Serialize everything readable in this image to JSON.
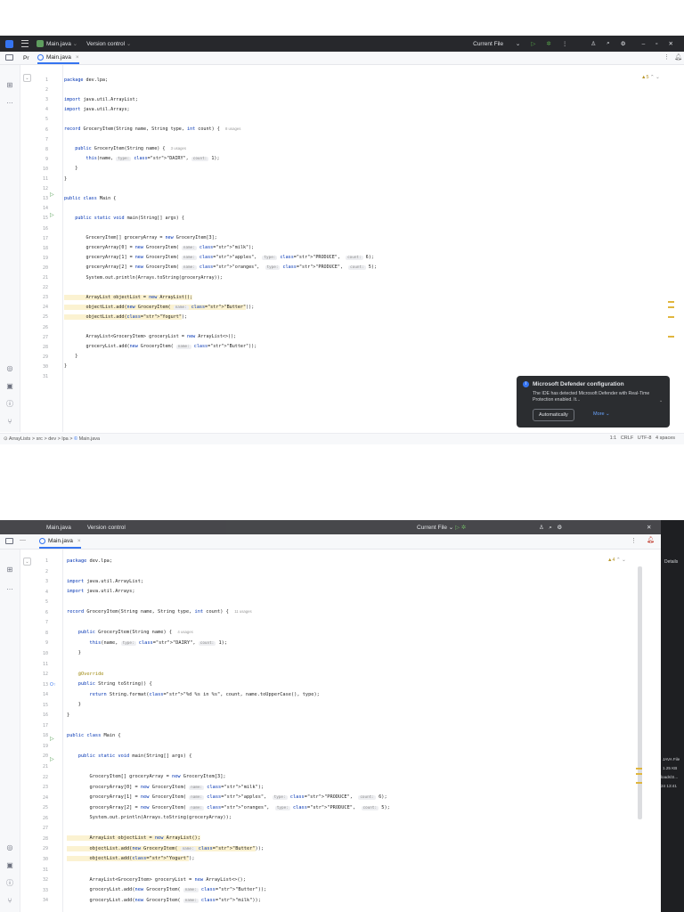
{
  "shot1": {
    "titlebar": {
      "file": "Main.java",
      "vcs": "Version control",
      "run_config": "Current File"
    },
    "tabs": [
      "Pr",
      "Main.java"
    ],
    "inspections": "▲5",
    "code": [
      {
        "n": "1",
        "t": "package dev.lpa;"
      },
      {
        "n": "2",
        "t": ""
      },
      {
        "n": "3",
        "t": "import java.util.ArrayList;"
      },
      {
        "n": "4",
        "t": "import java.util.Arrays;"
      },
      {
        "n": "5",
        "t": ""
      },
      {
        "n": "6",
        "t": "record GroceryItem(String name, String type, int count) {",
        "usage": "8 usages"
      },
      {
        "n": "7",
        "t": ""
      },
      {
        "n": "8",
        "t": "    public GroceryItem(String name) {",
        "usage": "3 usages"
      },
      {
        "n": "9",
        "t": "        this(name, ",
        "h1": "type:",
        "s1": "\"DAIRY\"",
        ", ": "",
        "h2": "count:",
        "s2": "1);"
      },
      {
        "n": "10",
        "t": "    }"
      },
      {
        "n": "11",
        "t": "}"
      },
      {
        "n": "12",
        "t": ""
      },
      {
        "n": "13",
        "t": "public class Main {"
      },
      {
        "n": "14",
        "t": ""
      },
      {
        "n": "15",
        "t": "    public static void main(String[] args) {"
      },
      {
        "n": "16",
        "t": ""
      },
      {
        "n": "17",
        "t": "        GroceryItem[] groceryArray = new GroceryItem[3];"
      },
      {
        "n": "18",
        "t": "        groceryArray[0] = new GroceryItem( name: \"milk\");"
      },
      {
        "n": "19",
        "t": "        groceryArray[1] = new GroceryItem( name: \"apples\",  type: \"PRODUCE\",  count: 6);"
      },
      {
        "n": "20",
        "t": "        groceryArray[2] = new GroceryItem( name: \"oranges\",  type: \"PRODUCE\",  count: 5);"
      },
      {
        "n": "21",
        "t": "        System.out.println(Arrays.toString(groceryArray));"
      },
      {
        "n": "22",
        "t": ""
      },
      {
        "n": "23",
        "t": "        ArrayList objectList = new ArrayList();"
      },
      {
        "n": "24",
        "t": "        objectList.add(new GroceryItem( name: \"Butter\"));"
      },
      {
        "n": "25",
        "t": "        objectList.add(\"Yogurt\");"
      },
      {
        "n": "26",
        "t": ""
      },
      {
        "n": "27",
        "t": "        ArrayList<GroceryItem> groceryList = new ArrayList<>();"
      },
      {
        "n": "28",
        "t": "        groceryList.add(new GroceryItem( name: \"Butter\"));"
      },
      {
        "n": "29",
        "t": "    }"
      },
      {
        "n": "30",
        "t": "}"
      },
      {
        "n": "31",
        "t": ""
      }
    ],
    "notification": {
      "title": "Microsoft Defender configuration",
      "body": "The IDE has detected Microsoft Defender with Real-Time Protection enabled. It...",
      "button": "Automatically",
      "more": "More"
    },
    "status": {
      "breadcrumb": [
        "ArrayLists",
        "src",
        "dev",
        "lpa",
        "Main.java"
      ],
      "position": "1:1",
      "line_sep": "CRLF",
      "encoding": "UTF-8",
      "indent": "4 spaces"
    }
  },
  "shot2": {
    "titlebar": {
      "file": "Main.java",
      "vcs": "Version control",
      "run_config": "Current File"
    },
    "tabs": [
      "Main.java"
    ],
    "inspections": "▲4",
    "side_panel": {
      "title": "Details",
      "lines": [
        "JAVA File",
        "1.25 KB",
        "loads\\S...",
        "24 13:41"
      ]
    },
    "code_lines": [
      "1",
      "2",
      "3",
      "4",
      "5",
      "6",
      "7",
      "8",
      "9",
      "10",
      "11",
      "12",
      "13",
      "14",
      "15",
      "16",
      "17",
      "18",
      "19",
      "20",
      "21",
      "22",
      "23",
      "24",
      "25",
      "26",
      "27",
      "28",
      "29",
      "30",
      "31",
      "32",
      "33",
      "34"
    ]
  },
  "colors": {
    "accent": "#3574f0",
    "keyword": "#0033b3",
    "string": "#067d17",
    "annotation": "#9e880d",
    "warning": "#e0b63e"
  }
}
